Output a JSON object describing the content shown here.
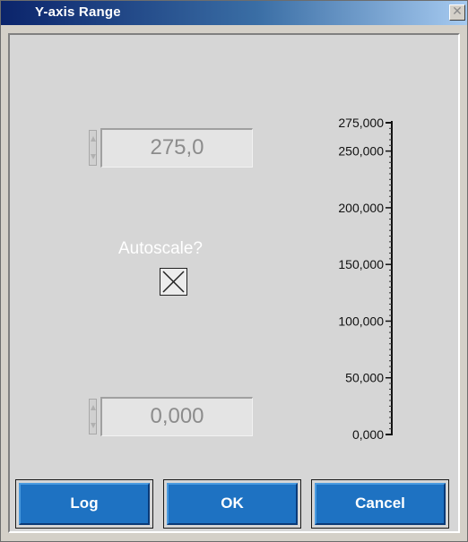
{
  "window": {
    "title": "Y-axis Range",
    "close_glyph": "✕"
  },
  "max_control": {
    "value": "275,0"
  },
  "min_control": {
    "value": "0,000"
  },
  "autoscale": {
    "label": "Autoscale?",
    "checked": true
  },
  "scale": {
    "ticks": [
      "275,000",
      "250,000",
      "200,000",
      "150,000",
      "100,000",
      "50,000",
      "0,000"
    ],
    "tick_values": [
      275,
      250,
      200,
      150,
      100,
      50,
      0
    ],
    "max": 275,
    "min": 0
  },
  "buttons": {
    "log_label": "Log",
    "ok_label": "OK",
    "cancel_label": "Cancel"
  },
  "colors": {
    "title_bar_start": "#0b246b",
    "title_bar_end": "#a6caf0",
    "button_blue": "#1e72c2",
    "field_text": "#8c8c8c"
  }
}
